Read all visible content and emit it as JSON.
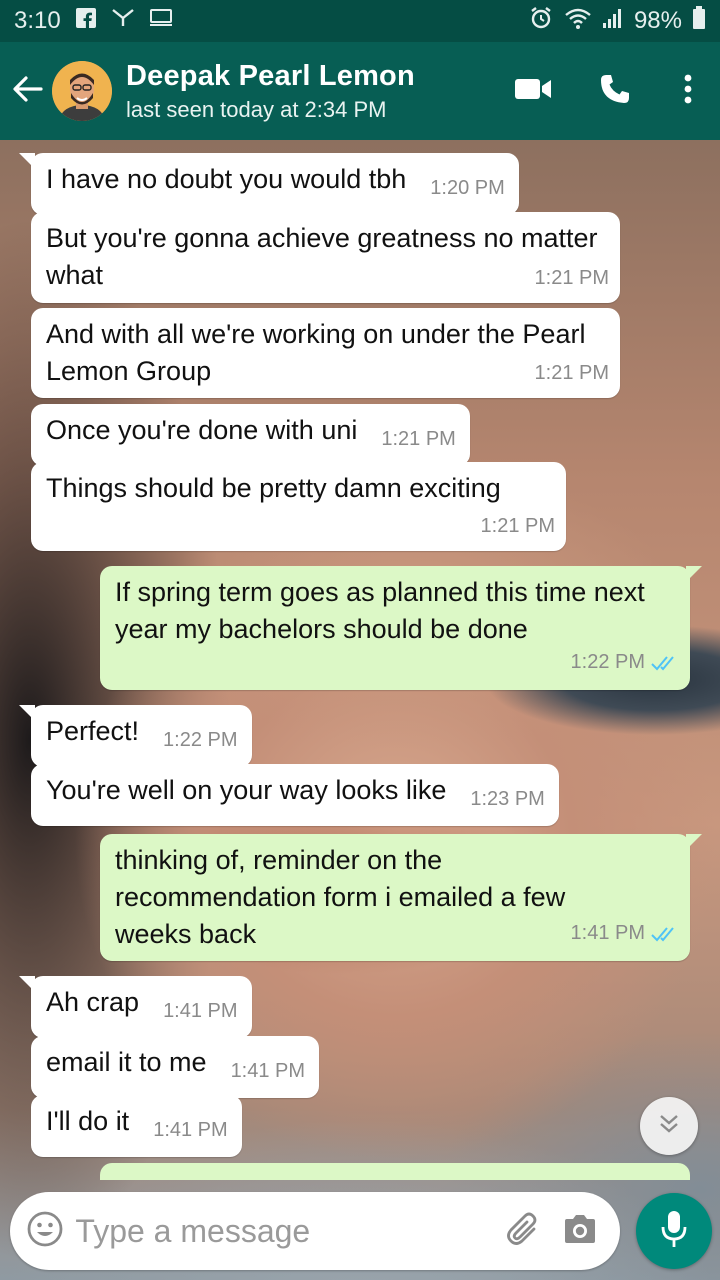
{
  "status_bar": {
    "time": "3:10",
    "battery": "98%"
  },
  "header": {
    "contact_name": "Deepak Pearl Lemon",
    "last_seen": "last seen today at 2:34 PM"
  },
  "messages": [
    {
      "direction": "in",
      "text": "I have no doubt you would tbh",
      "time": "1:20 PM"
    },
    {
      "direction": "in",
      "text": "But you're gonna achieve greatness no matter what",
      "time": "1:21 PM"
    },
    {
      "direction": "in",
      "text": "And with all we're working on under the Pearl Lemon Group",
      "time": "1:21 PM"
    },
    {
      "direction": "in",
      "text": "Once you're done with uni",
      "time": "1:21 PM"
    },
    {
      "direction": "in",
      "text": "Things should be pretty damn exciting",
      "time": "1:21 PM"
    },
    {
      "direction": "out",
      "text": "If spring term goes as planned this time next year my bachelors should be done",
      "time": "1:22 PM",
      "status": "read"
    },
    {
      "direction": "in",
      "text": "Perfect!",
      "time": "1:22 PM"
    },
    {
      "direction": "in",
      "text": "You're well on your way looks like",
      "time": "1:23 PM"
    },
    {
      "direction": "out",
      "text": "thinking of, reminder on the recommendation form i emailed a few weeks back",
      "time": "1:41 PM",
      "status": "read"
    },
    {
      "direction": "in",
      "text": "Ah crap",
      "time": "1:41 PM"
    },
    {
      "direction": "in",
      "text": "email it to me",
      "time": "1:41 PM"
    },
    {
      "direction": "in",
      "text": "I'll do it",
      "time": "1:41 PM"
    }
  ],
  "composer": {
    "placeholder": "Type a message"
  },
  "icons": {
    "back": "arrow-left-icon",
    "video": "video-call-icon",
    "call": "phone-icon",
    "menu": "more-vertical-icon",
    "emoji": "emoji-icon",
    "attach": "paperclip-icon",
    "camera": "camera-icon",
    "mic": "mic-icon",
    "scroll": "double-chevron-down-icon"
  },
  "colors": {
    "header": "#075e54",
    "status_bar": "#054d44",
    "incoming_bubble": "#ffffff",
    "outgoing_bubble": "#dcf8c6",
    "read_ticks": "#4fc3f7",
    "accent": "#00897b"
  }
}
